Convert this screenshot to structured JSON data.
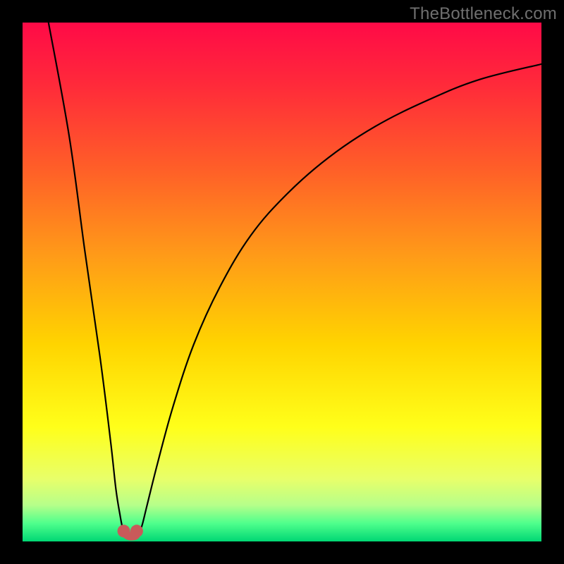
{
  "watermark": "TheBottleneck.com",
  "gradient": {
    "stops": [
      {
        "offset": 0.0,
        "color": "#ff0a47"
      },
      {
        "offset": 0.12,
        "color": "#ff2a3a"
      },
      {
        "offset": 0.28,
        "color": "#ff5e28"
      },
      {
        "offset": 0.45,
        "color": "#ff9b18"
      },
      {
        "offset": 0.62,
        "color": "#ffd400"
      },
      {
        "offset": 0.78,
        "color": "#ffff1a"
      },
      {
        "offset": 0.88,
        "color": "#e8ff6a"
      },
      {
        "offset": 0.93,
        "color": "#b6ff8a"
      },
      {
        "offset": 0.965,
        "color": "#4fff8c"
      },
      {
        "offset": 1.0,
        "color": "#00d774"
      }
    ]
  },
  "chart_data": {
    "type": "line",
    "title": "",
    "xlabel": "",
    "ylabel": "",
    "xlim": [
      0,
      100
    ],
    "ylim": [
      0,
      100
    ],
    "series": [
      {
        "name": "left-branch",
        "x": [
          5,
          9,
          12,
          15,
          17,
          18,
          18.8,
          19.3,
          19.8
        ],
        "y": [
          100,
          78,
          56,
          35,
          19,
          10,
          5,
          2.5,
          1.5
        ]
      },
      {
        "name": "right-branch",
        "x": [
          22.3,
          23,
          24,
          26,
          29,
          33,
          38,
          44,
          51,
          59,
          68,
          78,
          88,
          100
        ],
        "y": [
          1.5,
          3,
          7,
          15,
          26,
          38,
          49,
          59,
          67,
          74,
          80,
          85,
          89,
          92
        ]
      }
    ],
    "markers": [
      {
        "name": "left-dot",
        "x": 19.5,
        "y": 2.0
      },
      {
        "name": "right-dot",
        "x": 22.0,
        "y": 2.0
      }
    ],
    "bridge": {
      "x": [
        19.5,
        20.2,
        21.0,
        21.8,
        22.0
      ],
      "y": [
        2.0,
        1.2,
        1.0,
        1.2,
        2.0
      ]
    },
    "colors": {
      "curve": "#000000",
      "marker": "#c85a5a",
      "bridge": "#c85a5a"
    }
  }
}
